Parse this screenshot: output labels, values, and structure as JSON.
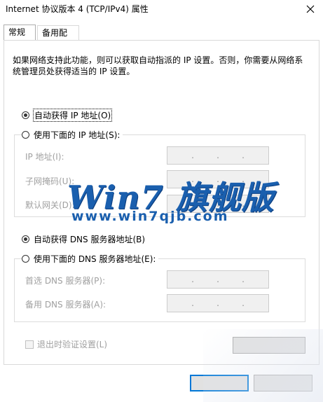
{
  "window": {
    "title": "Internet 协议版本 4 (TCP/IPv4) 属性",
    "close_icon": "close-icon"
  },
  "tabs": [
    {
      "label": "常规",
      "active": true
    },
    {
      "label": "备用配置",
      "active": false
    }
  ],
  "description": "如果网络支持此功能，则可以获取自动指派的 IP 设置。否则，你需要从网络系统管理员处获得适当的 IP 设置。",
  "ip_section": {
    "auto_label": "自动获得 IP 地址(O)",
    "auto_selected": true,
    "manual_label": "使用下面的 IP 地址(S):",
    "manual_selected": false,
    "fields": [
      {
        "label": "IP 地址(I):",
        "value": ". . ."
      },
      {
        "label": "子网掩码(U):",
        "value": ". . ."
      },
      {
        "label": "默认网关(D):",
        "value": ". . ."
      }
    ]
  },
  "dns_section": {
    "auto_label": "自动获得 DNS 服务器地址(B)",
    "auto_selected": true,
    "manual_label": "使用下面的 DNS 服务器地址(E):",
    "manual_selected": false,
    "fields": [
      {
        "label": "首选 DNS 服务器(P):",
        "value": ". . ."
      },
      {
        "label": "备用 DNS 服务器(A):",
        "value": ". . ."
      }
    ]
  },
  "validate_on_exit": {
    "label": "退出时验证设置(L)",
    "checked": false,
    "enabled": false
  },
  "watermark": {
    "main": "Win7 旗舰版",
    "url": "www.win7qjb.com"
  },
  "colors": {
    "accent": "#0078d7",
    "watermark": "#1a5fae",
    "disabled_text": "#a0a0a0"
  }
}
